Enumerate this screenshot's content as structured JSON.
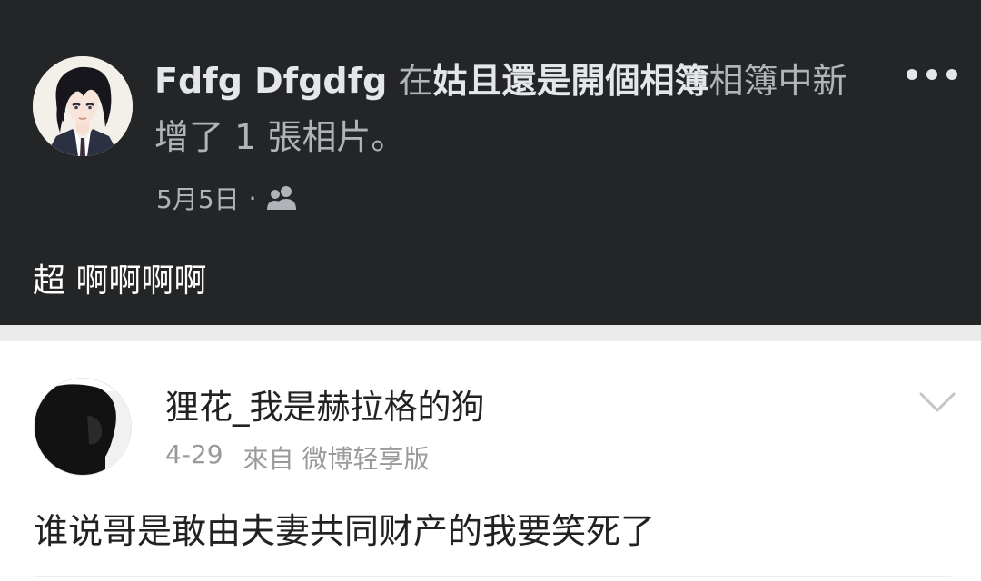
{
  "fb_post": {
    "author": "Fdfg Dfgdfg",
    "action_prefix": " 在",
    "album_name": "姑且還是開個相簿",
    "action_suffix": "相簿中新增了 1 張相片。",
    "date": "5月5日",
    "separator": "·",
    "privacy_icon": "friends-icon",
    "more_icon": "more-horizontal-icon",
    "body": "超 啊啊啊啊"
  },
  "comment": {
    "username": "狸花_我是赫拉格的狗",
    "date": "4-29",
    "source": "來自 微博轻享版",
    "text": "谁说哥是敢由夫妻共同财产的我要笑死了",
    "menu_icon": "chevron-down-icon"
  },
  "colors": {
    "fb_background": "#242526",
    "page_background": "#ffffff",
    "divider": "#ebebeb"
  }
}
